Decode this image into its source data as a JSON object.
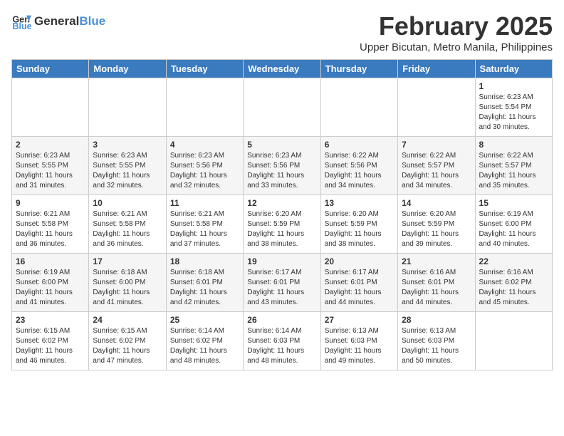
{
  "header": {
    "logo_general": "General",
    "logo_blue": "Blue",
    "month_title": "February 2025",
    "location": "Upper Bicutan, Metro Manila, Philippines"
  },
  "weekdays": [
    "Sunday",
    "Monday",
    "Tuesday",
    "Wednesday",
    "Thursday",
    "Friday",
    "Saturday"
  ],
  "weeks": [
    [
      {
        "day": "",
        "info": ""
      },
      {
        "day": "",
        "info": ""
      },
      {
        "day": "",
        "info": ""
      },
      {
        "day": "",
        "info": ""
      },
      {
        "day": "",
        "info": ""
      },
      {
        "day": "",
        "info": ""
      },
      {
        "day": "1",
        "info": "Sunrise: 6:23 AM\nSunset: 5:54 PM\nDaylight: 11 hours\nand 30 minutes."
      }
    ],
    [
      {
        "day": "2",
        "info": "Sunrise: 6:23 AM\nSunset: 5:55 PM\nDaylight: 11 hours\nand 31 minutes."
      },
      {
        "day": "3",
        "info": "Sunrise: 6:23 AM\nSunset: 5:55 PM\nDaylight: 11 hours\nand 32 minutes."
      },
      {
        "day": "4",
        "info": "Sunrise: 6:23 AM\nSunset: 5:56 PM\nDaylight: 11 hours\nand 32 minutes."
      },
      {
        "day": "5",
        "info": "Sunrise: 6:23 AM\nSunset: 5:56 PM\nDaylight: 11 hours\nand 33 minutes."
      },
      {
        "day": "6",
        "info": "Sunrise: 6:22 AM\nSunset: 5:56 PM\nDaylight: 11 hours\nand 34 minutes."
      },
      {
        "day": "7",
        "info": "Sunrise: 6:22 AM\nSunset: 5:57 PM\nDaylight: 11 hours\nand 34 minutes."
      },
      {
        "day": "8",
        "info": "Sunrise: 6:22 AM\nSunset: 5:57 PM\nDaylight: 11 hours\nand 35 minutes."
      }
    ],
    [
      {
        "day": "9",
        "info": "Sunrise: 6:21 AM\nSunset: 5:58 PM\nDaylight: 11 hours\nand 36 minutes."
      },
      {
        "day": "10",
        "info": "Sunrise: 6:21 AM\nSunset: 5:58 PM\nDaylight: 11 hours\nand 36 minutes."
      },
      {
        "day": "11",
        "info": "Sunrise: 6:21 AM\nSunset: 5:58 PM\nDaylight: 11 hours\nand 37 minutes."
      },
      {
        "day": "12",
        "info": "Sunrise: 6:20 AM\nSunset: 5:59 PM\nDaylight: 11 hours\nand 38 minutes."
      },
      {
        "day": "13",
        "info": "Sunrise: 6:20 AM\nSunset: 5:59 PM\nDaylight: 11 hours\nand 38 minutes."
      },
      {
        "day": "14",
        "info": "Sunrise: 6:20 AM\nSunset: 5:59 PM\nDaylight: 11 hours\nand 39 minutes."
      },
      {
        "day": "15",
        "info": "Sunrise: 6:19 AM\nSunset: 6:00 PM\nDaylight: 11 hours\nand 40 minutes."
      }
    ],
    [
      {
        "day": "16",
        "info": "Sunrise: 6:19 AM\nSunset: 6:00 PM\nDaylight: 11 hours\nand 41 minutes."
      },
      {
        "day": "17",
        "info": "Sunrise: 6:18 AM\nSunset: 6:00 PM\nDaylight: 11 hours\nand 41 minutes."
      },
      {
        "day": "18",
        "info": "Sunrise: 6:18 AM\nSunset: 6:01 PM\nDaylight: 11 hours\nand 42 minutes."
      },
      {
        "day": "19",
        "info": "Sunrise: 6:17 AM\nSunset: 6:01 PM\nDaylight: 11 hours\nand 43 minutes."
      },
      {
        "day": "20",
        "info": "Sunrise: 6:17 AM\nSunset: 6:01 PM\nDaylight: 11 hours\nand 44 minutes."
      },
      {
        "day": "21",
        "info": "Sunrise: 6:16 AM\nSunset: 6:01 PM\nDaylight: 11 hours\nand 44 minutes."
      },
      {
        "day": "22",
        "info": "Sunrise: 6:16 AM\nSunset: 6:02 PM\nDaylight: 11 hours\nand 45 minutes."
      }
    ],
    [
      {
        "day": "23",
        "info": "Sunrise: 6:15 AM\nSunset: 6:02 PM\nDaylight: 11 hours\nand 46 minutes."
      },
      {
        "day": "24",
        "info": "Sunrise: 6:15 AM\nSunset: 6:02 PM\nDaylight: 11 hours\nand 47 minutes."
      },
      {
        "day": "25",
        "info": "Sunrise: 6:14 AM\nSunset: 6:02 PM\nDaylight: 11 hours\nand 48 minutes."
      },
      {
        "day": "26",
        "info": "Sunrise: 6:14 AM\nSunset: 6:03 PM\nDaylight: 11 hours\nand 48 minutes."
      },
      {
        "day": "27",
        "info": "Sunrise: 6:13 AM\nSunset: 6:03 PM\nDaylight: 11 hours\nand 49 minutes."
      },
      {
        "day": "28",
        "info": "Sunrise: 6:13 AM\nSunset: 6:03 PM\nDaylight: 11 hours\nand 50 minutes."
      },
      {
        "day": "",
        "info": ""
      }
    ]
  ]
}
